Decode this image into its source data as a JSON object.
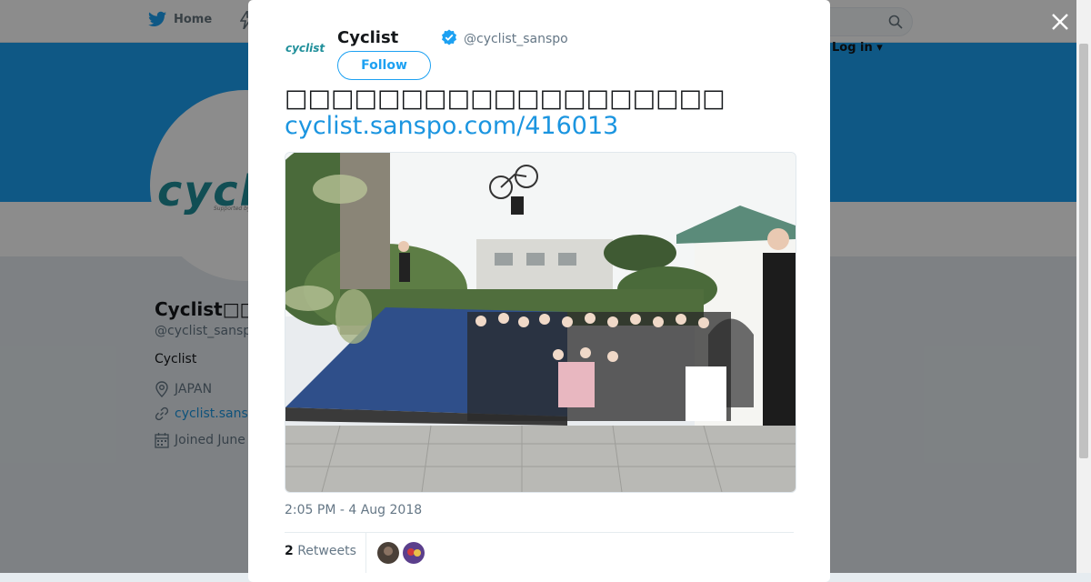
{
  "nav": {
    "home_label": "Home",
    "login_label": "Log in ▾"
  },
  "profile": {
    "avatar_logo": "cycl",
    "avatar_sub": "Supported by",
    "name": "Cyclist□□",
    "handle": "@cyclist_sansp",
    "bio": "Cyclist",
    "location": "JAPAN",
    "website": "cyclist.sans",
    "joined": "Joined June"
  },
  "tweet": {
    "author_name": "Cyclist",
    "author_handle": "@cyclist_sanspo",
    "avatar_text": "cyclist",
    "follow_label": "Follow",
    "text": "□□□□□□□□□□□□□□□□□□□",
    "link": "cyclist.sanspo.com/416013",
    "timestamp": "2:05 PM - 4 Aug 2018",
    "retweet_count": "2",
    "retweet_label": "Retweets"
  },
  "colors": {
    "brand": "#1da1f2",
    "link": "#1b95e0",
    "text": "#14171a",
    "muted": "#657786"
  },
  "icons": {
    "home": "twitter-bird-icon",
    "close": "close-icon",
    "verified": "verified-badge-icon",
    "search": "search-icon",
    "location": "location-pin-icon",
    "link": "link-icon",
    "calendar": "calendar-icon"
  }
}
